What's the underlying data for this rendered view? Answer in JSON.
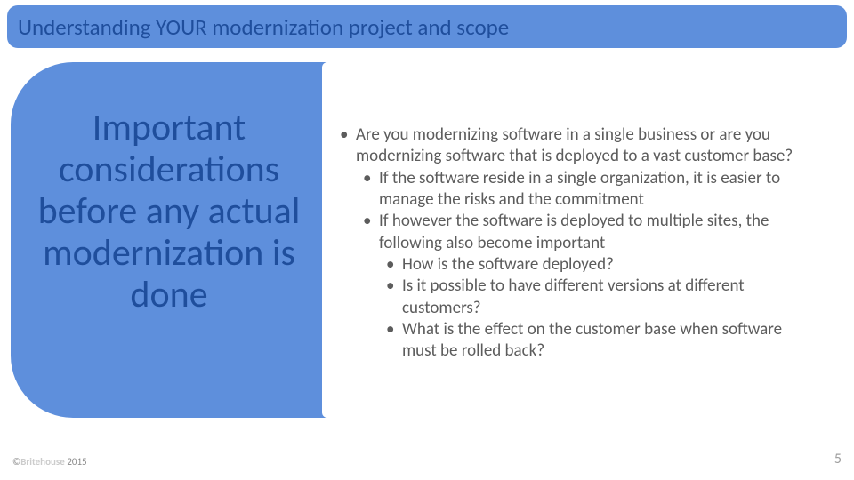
{
  "title": "Understanding YOUR modernization project and scope",
  "left_heading": "Important considerations before any actual modernization is done",
  "bullets": {
    "b1": "Are you modernizing software in a single business or are you modernizing software that is deployed to a vast customer base?",
    "b1a": "If the software reside in a single organization, it is easier to manage the risks and the commitment",
    "b1b": "If however the software is deployed to multiple sites, the following also become important",
    "b1b1": "How is the software deployed?",
    "b1b2": "Is it possible to have different versions at different customers?",
    "b1b3": "What is the effect on the customer base when software must be rolled back?"
  },
  "footer": {
    "copyright_symbol": "©",
    "brand": "Britehouse",
    "year": "2015"
  },
  "page_number": "5"
}
